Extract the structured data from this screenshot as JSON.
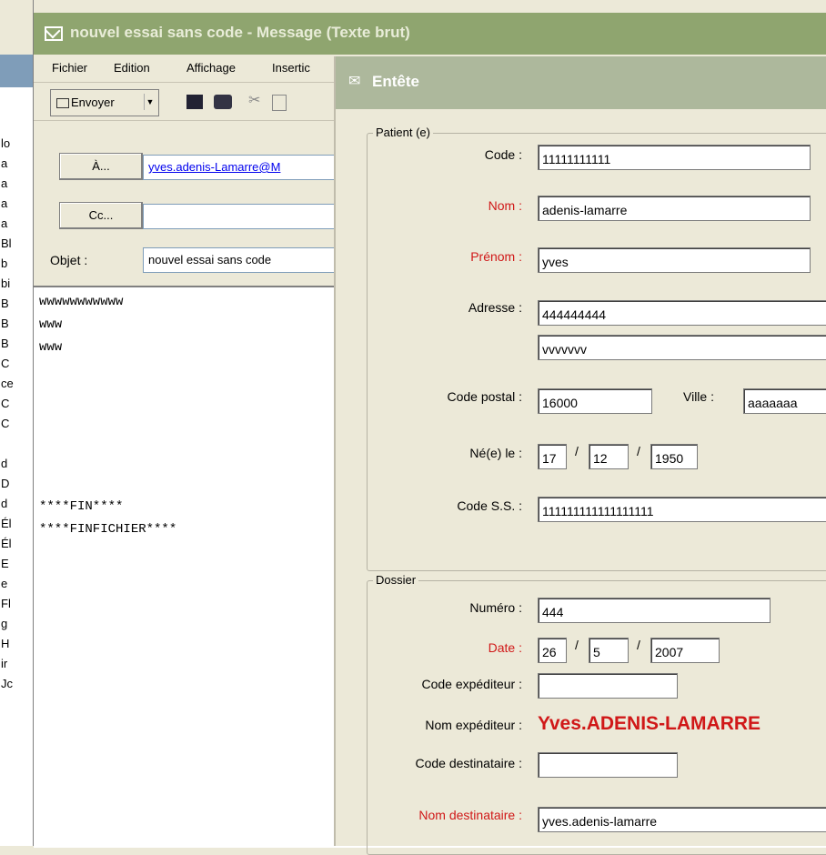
{
  "left_strip": {
    "items": [
      "lo",
      "a",
      "a",
      "a",
      "a",
      "Bl",
      "b",
      "bi",
      "B",
      "B",
      "B",
      "C",
      "ce",
      "C",
      "C",
      "",
      "d",
      "D",
      "d",
      "Él",
      "Él",
      "E",
      "e",
      "Fl",
      "g",
      "H",
      "ir",
      "Jc"
    ]
  },
  "message_window": {
    "title": "nouvel essai sans code - Message (Texte brut)",
    "menu": [
      "Fichier",
      "Edition",
      "Affichage",
      "Insertic"
    ],
    "toolbar": {
      "send_label": "Envoyer"
    },
    "to_button": "À...",
    "cc_button": "Cc...",
    "to_value": "yves.adenis-Lamarre@M",
    "cc_value": "",
    "subject_label": "Objet :",
    "subject_value": "nouvel essai sans code",
    "body_lines": [
      "wwwwwwwwwww",
      "www",
      "www",
      "",
      "",
      "",
      "",
      "",
      "",
      "****FIN****",
      "****FINFICHIER****"
    ]
  },
  "dialog": {
    "title": "Entête",
    "patient_group": {
      "legend": "Patient (e)",
      "code_label": "Code :",
      "code_value": "11111111111",
      "nom_label": "Nom :",
      "nom_value": "adenis-lamarre",
      "prenom_label": "Prénom :",
      "prenom_value": "yves",
      "adresse_label": "Adresse :",
      "adresse_value1": "444444444",
      "adresse_value2": "vvvvvvv",
      "cp_label": "Code postal :",
      "cp_value": "16000",
      "ville_label": "Ville :",
      "ville_value": "aaaaaaa",
      "ne_label": "Né(e) le :",
      "ne_day": "17",
      "ne_month": "12",
      "ne_year": "1950",
      "ss_label": "Code S.S. :",
      "ss_value": "111111111111111111"
    },
    "dossier_group": {
      "legend": "Dossier",
      "numero_label": "Numéro :",
      "numero_value": "444",
      "date_label": "Date :",
      "date_day": "26",
      "date_month": "5",
      "date_year": "2007",
      "code_exp_label": "Code expéditeur :",
      "code_exp_value": "",
      "nom_exp_label": "Nom expéditeur :",
      "nom_exp_value": "Yves.ADENIS-LAMARRE",
      "code_dest_label": "Code destinataire :",
      "code_dest_value": "",
      "nom_dest_label": "Nom destinataire :",
      "nom_dest_value": "yves.adenis-lamarre"
    },
    "separator": "/"
  },
  "colors": {
    "title_bar": "#8fa56f",
    "dialog_title": "#adb89c",
    "required_label": "#d01818"
  }
}
